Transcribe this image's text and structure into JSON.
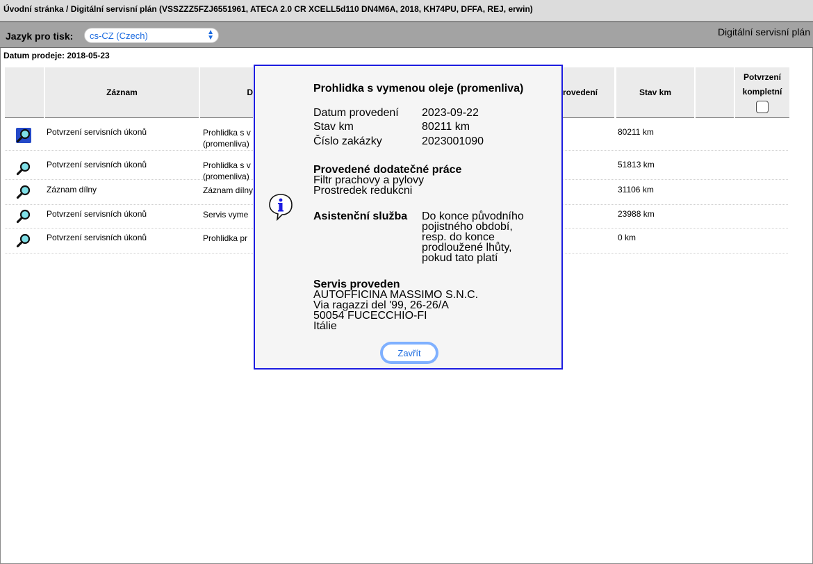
{
  "titlebar": {
    "text": "Úvodní stránka / Digitální servisní plán (VSSZZZ5FZJ6551961, ATECA 2.0 CR XCELL5d110 DN4M6A, 2018, KH74PU, DFFA, REJ, erwin)"
  },
  "toolbar": {
    "lang_label": "Jazyk pro tisk:",
    "lang_value": "cs-CZ (Czech)",
    "app_title": "Digitální servisní plán"
  },
  "sale_date": "Datum prodeje: 2018-05-23",
  "table": {
    "headers": {
      "record": "Záznam",
      "desc": "D",
      "date": "rovedení",
      "km": "Stav km",
      "confirm_line1": "Potvrzení",
      "confirm_line2": "kompletní"
    },
    "rows": [
      {
        "type": "Potvrzení servisních úkonů",
        "desc_a": "Prohlidka s v",
        "desc_b": "(promenliva)",
        "km": "80211 km"
      },
      {
        "type": "Potvrzení servisních úkonů",
        "desc_a": "Prohlidka s v",
        "desc_b": "(promenliva)",
        "km": "51813 km"
      },
      {
        "type": "Záznam dílny",
        "desc_a": "Záznam dílny",
        "desc_b": "",
        "km": "31106 km"
      },
      {
        "type": "Potvrzení servisních úkonů",
        "desc_a": "Servis vyme",
        "desc_b": "",
        "km": "23988 km"
      },
      {
        "type": "Potvrzení servisních úkonů",
        "desc_a": "Prohlidka pr",
        "desc_b": "",
        "km": "0 km"
      }
    ]
  },
  "modal": {
    "title": "Prohlidka s vymenou oleje (promenliva)",
    "date_label": "Datum provedení",
    "date_value": "2023-09-22",
    "km_label": "Stav km",
    "km_value": "80211 km",
    "order_label": "Číslo zakázky",
    "order_value": "2023001090",
    "extra_title": "Provedené dodatečné práce",
    "extra_1": "Filtr prachovy a pylovy",
    "extra_2": "Prostredek redukcni",
    "assist_label": "Asistenční služba",
    "assist_1": "Do konce původního",
    "assist_2": "pojistného období,",
    "assist_3": "resp. do konce",
    "assist_4": "prodloužené lhůty,",
    "assist_5": "pokud tato platí",
    "service_title": "Servis proveden",
    "svc_1": "AUTOFFICINA MASSIMO S.N.C.",
    "svc_2": "Via ragazzi del '99, 26-26/A",
    "svc_3": "50054 FUCECCHIO-FI",
    "svc_4": "Itálie",
    "close_label": "Zavřít"
  },
  "icons": {
    "lens": "magnifier-icon",
    "info": "info-icon",
    "select_arrows": "updown-chevron-icon"
  }
}
